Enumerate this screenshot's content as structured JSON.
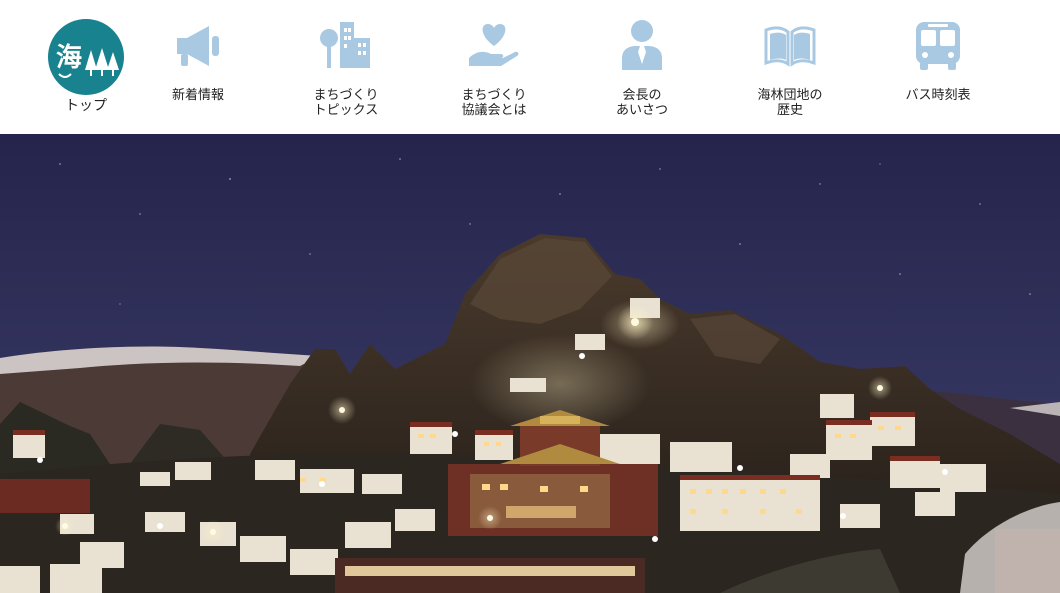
{
  "nav": {
    "home": {
      "logo_text": "海",
      "label": "トップ"
    },
    "items": [
      {
        "label": "新着情報",
        "icon": "megaphone-icon"
      },
      {
        "label": "まちづくり\nトピックス",
        "icon": "town-buildings-icon"
      },
      {
        "label": "まちづくり\n協議会とは",
        "icon": "heart-hand-icon"
      },
      {
        "label": "会長の\nあいさつ",
        "icon": "person-icon"
      },
      {
        "label": "海林団地の\n歴史",
        "icon": "open-book-icon"
      },
      {
        "label": "バス時刻表",
        "icon": "bus-icon"
      }
    ]
  },
  "colors": {
    "icon": "#a9c9e2",
    "logo_bg": "#18838f",
    "sky_top": "#25244c",
    "sky_bottom": "#3b3d6a"
  }
}
